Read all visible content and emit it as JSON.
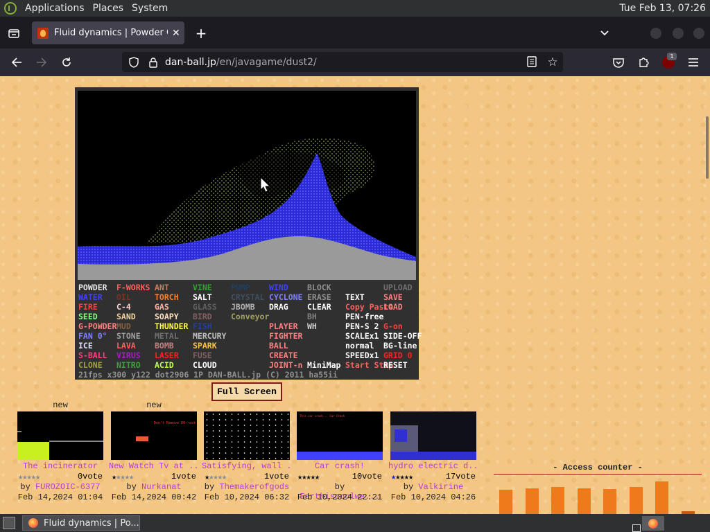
{
  "system_bar": {
    "menus": [
      "Applications",
      "Places",
      "System"
    ],
    "clock": "Tue Feb 13, 07:26"
  },
  "browser": {
    "tab_title": "Fluid dynamics | Powder Game",
    "url_host": "dan-ball.jp",
    "url_path": "/en/javagame/dust2/",
    "extension_badge": "1"
  },
  "game": {
    "panel": [
      [
        {
          "t": "POWDER",
          "c": "#e8e8e8"
        },
        {
          "t": "F-WORKS",
          "c": "#ff6060"
        },
        {
          "t": "ANT",
          "c": "#c08060"
        },
        {
          "t": "VINE",
          "c": "#30a030"
        },
        {
          "t": "PUMP",
          "c": "#204060"
        },
        {
          "t": "WIND",
          "c": "#4040ff"
        },
        {
          "t": "BLOCK",
          "c": "#909090"
        },
        {
          "t": "",
          "c": "#e8e8e8"
        },
        {
          "t": "UPLOAD",
          "c": "#707070"
        }
      ],
      [
        {
          "t": "WATER",
          "c": "#4040ff"
        },
        {
          "t": "OIL",
          "c": "#803020"
        },
        {
          "t": "TORCH",
          "c": "#ff8020"
        },
        {
          "t": "SALT",
          "c": "#ffffff"
        },
        {
          "t": "CRYSTAL",
          "c": "#405060"
        },
        {
          "t": "CYCLONE",
          "c": "#8080ff"
        },
        {
          "t": "ERASE",
          "c": "#909090"
        },
        {
          "t": "TEXT",
          "c": "#ffffff"
        },
        {
          "t": "SAVE",
          "c": "#ff8080"
        }
      ],
      [
        {
          "t": "FIRE",
          "c": "#ff4040"
        },
        {
          "t": "C-4",
          "c": "#ffd0d0"
        },
        {
          "t": "GAS",
          "c": "#ffb0a0"
        },
        {
          "t": "GLASS",
          "c": "#606060"
        },
        {
          "t": "JBOMB",
          "c": "#b0b0b0"
        },
        {
          "t": "DRAG",
          "c": "#ffffff"
        },
        {
          "t": "CLEAR",
          "c": "#ffffff"
        },
        {
          "t": "Copy Paste",
          "c": "#ff6060"
        },
        {
          "t": "LOAD",
          "c": "#ff8080"
        }
      ],
      [
        {
          "t": "SEED",
          "c": "#80ff80"
        },
        {
          "t": "SAND",
          "c": "#f0d0a0"
        },
        {
          "t": "SOAPY",
          "c": "#ffe0c0"
        },
        {
          "t": "BIRD",
          "c": "#806060"
        },
        {
          "t": "Conveyor",
          "c": "#a0a060"
        },
        {
          "t": "",
          "c": "#e8e8e8"
        },
        {
          "t": "BH",
          "c": "#808080"
        },
        {
          "t": "PEN-free",
          "c": "#ffffff"
        },
        {
          "t": "",
          "c": "#e8e8e8"
        }
      ],
      [
        {
          "t": "G-POWDER",
          "c": "#ff8080"
        },
        {
          "t": "MUD",
          "c": "#806040"
        },
        {
          "t": "THUNDER",
          "c": "#ffff40"
        },
        {
          "t": "FISH",
          "c": "#2040a0"
        },
        {
          "t": "",
          "c": "#e8e8e8"
        },
        {
          "t": "PLAYER",
          "c": "#ff8080"
        },
        {
          "t": "WH",
          "c": "#d0d0d0"
        },
        {
          "t": "PEN-S 2",
          "c": "#ffffff"
        },
        {
          "t": "G-on",
          "c": "#ff4040"
        }
      ],
      [
        {
          "t": "FAN 0°",
          "c": "#8080ff"
        },
        {
          "t": "STONE",
          "c": "#a0a0a0"
        },
        {
          "t": "METAL",
          "c": "#707070"
        },
        {
          "t": "MERCURY",
          "c": "#c0c0c0"
        },
        {
          "t": "",
          "c": "#e8e8e8"
        },
        {
          "t": "FIGHTER",
          "c": "#ff8080"
        },
        {
          "t": "",
          "c": "#e8e8e8"
        },
        {
          "t": "SCALEx1",
          "c": "#ffffff"
        },
        {
          "t": "SIDE-OFF",
          "c": "#ffffff"
        }
      ],
      [
        {
          "t": "ICE",
          "c": "#e0e0ff"
        },
        {
          "t": "LAVA",
          "c": "#ff6060"
        },
        {
          "t": "BOMB",
          "c": "#c08080"
        },
        {
          "t": "SPARK",
          "c": "#ffc040"
        },
        {
          "t": "",
          "c": "#e8e8e8"
        },
        {
          "t": "BALL",
          "c": "#ff8080"
        },
        {
          "t": "",
          "c": "#e8e8e8"
        },
        {
          "t": "normal",
          "c": "#ffffff"
        },
        {
          "t": "BG-line",
          "c": "#ffffff"
        }
      ],
      [
        {
          "t": "S-BALL",
          "c": "#ff4080"
        },
        {
          "t": "VIRUS",
          "c": "#a020c0"
        },
        {
          "t": "LASER",
          "c": "#ff2020"
        },
        {
          "t": "FUSE",
          "c": "#806060"
        },
        {
          "t": "",
          "c": "#e8e8e8"
        },
        {
          "t": "CREATE",
          "c": "#ff8080"
        },
        {
          "t": "",
          "c": "#e8e8e8"
        },
        {
          "t": "SPEEDx1",
          "c": "#ffffff"
        },
        {
          "t": "GRID 0",
          "c": "#ff2020"
        }
      ],
      [
        {
          "t": "CLONE",
          "c": "#a0a040"
        },
        {
          "t": "NITRO",
          "c": "#40a040"
        },
        {
          "t": "ACID",
          "c": "#c0ff40"
        },
        {
          "t": "CLOUD",
          "c": "#ffffff"
        },
        {
          "t": "",
          "c": "#e8e8e8"
        },
        {
          "t": "JOINT-n",
          "c": "#ff8080"
        },
        {
          "t": "MiniMap",
          "c": "#ffffff"
        },
        {
          "t": "Start Stop",
          "c": "#ff6060"
        },
        {
          "t": "RESET",
          "c": "#ffffff"
        }
      ]
    ],
    "status": "21fps   x300 y122  dot2906  1P    DAN-BALL.jp (C) 2011 ha55ii"
  },
  "full_screen_label": "Full Screen",
  "cards": [
    {
      "new": "new",
      "title": "The incinerator",
      "rating": "0vote",
      "stars": 0,
      "author": "FUROZOIC-6377",
      "date": "Feb 14,2024 01:04"
    },
    {
      "new": "new",
      "title": "New Watch Tv at ...",
      "rating": "1vote",
      "stars": 1,
      "author": "Nurkanat",
      "date": "Feb 14,2024 00:42"
    },
    {
      "new": "",
      "title": "Satisfying, wall ...",
      "rating": "1vote",
      "stars": 1,
      "author": "Themakerofgods",
      "date": "Feb 10,2024 06:32"
    },
    {
      "new": "",
      "title": "Car crash!",
      "rating": "10vote",
      "stars": 5,
      "author": "Earthiscoolwe...",
      "date": "Feb 10,2024 22:21"
    },
    {
      "new": "",
      "title": "hydro electric d...",
      "rating": "17vote",
      "stars": 5,
      "author": "Valkirine",
      "date": "Feb 10,2024 04:26"
    }
  ],
  "by_label": "by",
  "access_counter_label": "- Access counter -",
  "access_counter_bars": [
    0.62,
    0.66,
    0.7,
    0.66,
    0.64,
    0.7,
    0.84,
    0.08
  ],
  "taskbar": {
    "window_title": "Fluid dynamics | Po..."
  },
  "colors": {
    "page_bg": "#f3c683",
    "link": "#b63bd2",
    "water": "#3a3af0",
    "plant": "#a0c060",
    "sand": "#9a9a9a"
  }
}
